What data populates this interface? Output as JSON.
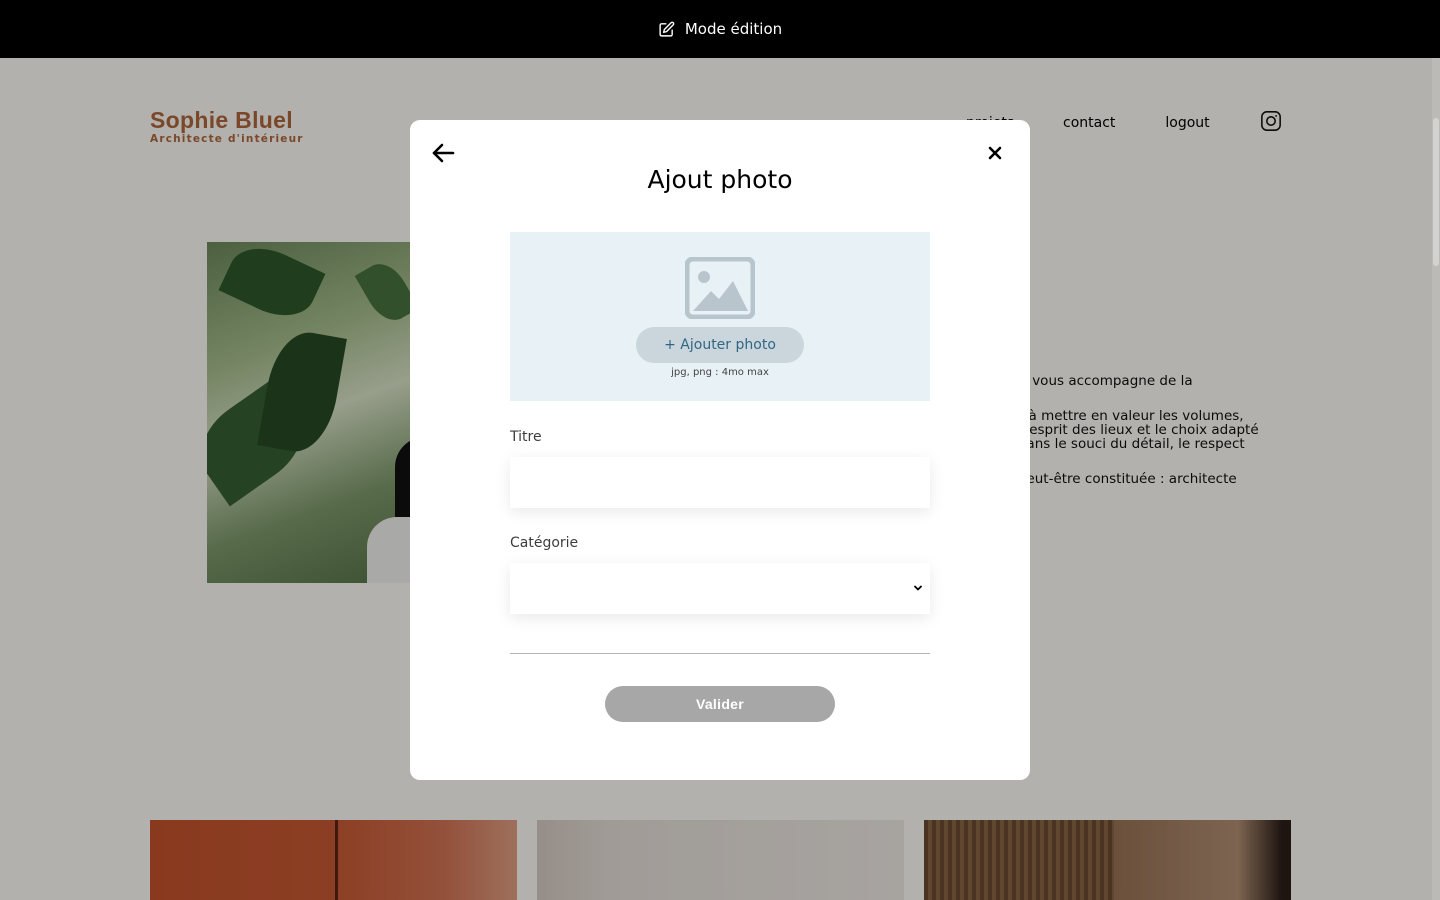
{
  "edit_bar": {
    "label": "Mode édition",
    "icon": "edit-icon"
  },
  "header": {
    "logo_title": "Sophie Bluel",
    "logo_subtitle": "Architecte d'intérieur",
    "nav": {
      "projets": "projets",
      "contact": "contact",
      "logout": "logout",
      "instagram_icon": "instagram-icon"
    }
  },
  "intro": {
    "paragraphs": [
      "s. Je vous accompagne de la",
      "çon à mettre en valeur les volumes,\nde l’esprit des lieux et le choix adapté\nré dans le souci du détail, le respect",
      "re peut-être constituée : architecte"
    ]
  },
  "modal": {
    "back_icon": "arrow-left-icon",
    "close_icon": "close-icon",
    "title": "Ajout photo",
    "upload": {
      "icon": "image-placeholder-icon",
      "button_label": "+ Ajouter photo",
      "hint": "jpg, png : 4mo max"
    },
    "title_field": {
      "label": "Titre",
      "value": ""
    },
    "category_field": {
      "label": "Catégorie",
      "selected": ""
    },
    "submit_label": "Valider"
  },
  "colors": {
    "brand": "#b1663c",
    "upload_bg": "#e8f1f6",
    "upload_button_bg": "#cbd6dc",
    "upload_button_text": "#306685",
    "submit_disabled": "#a7a7a7"
  }
}
